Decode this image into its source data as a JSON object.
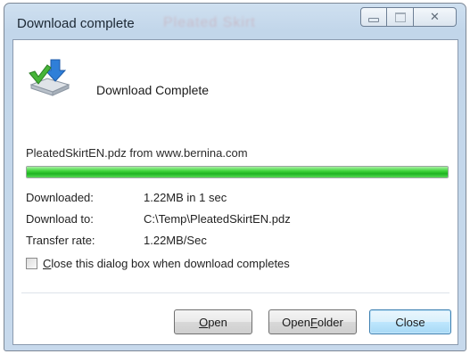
{
  "window": {
    "title": "Download complete",
    "background_title_text": "Pleated Skirt"
  },
  "content": {
    "heading": "Download Complete",
    "file_source": "PleatedSkirtEN.pdz from www.bernina.com",
    "progress_fraction": 1.0,
    "progress_color": "#2fc02c",
    "details": [
      {
        "label": "Downloaded:",
        "value": "1.22MB in 1 sec"
      },
      {
        "label": "Download to:",
        "value": "C:\\Temp\\PleatedSkirtEN.pdz"
      },
      {
        "label": "Transfer rate:",
        "value": "1.22MB/Sec"
      }
    ],
    "close_on_complete_label": "lose this dialog box when download completes",
    "close_on_complete_mnemonic": "C",
    "close_on_complete_checked": false
  },
  "buttons": {
    "open": {
      "mnemonic": "O",
      "rest": "pen"
    },
    "open_folder": {
      "pre": "Open ",
      "mnemonic": "F",
      "rest": "older"
    },
    "close": "Close"
  },
  "icons": {
    "download": "download-complete-icon",
    "minimize": "minimize-icon",
    "maximize": "maximize-icon",
    "close": "close-icon"
  }
}
